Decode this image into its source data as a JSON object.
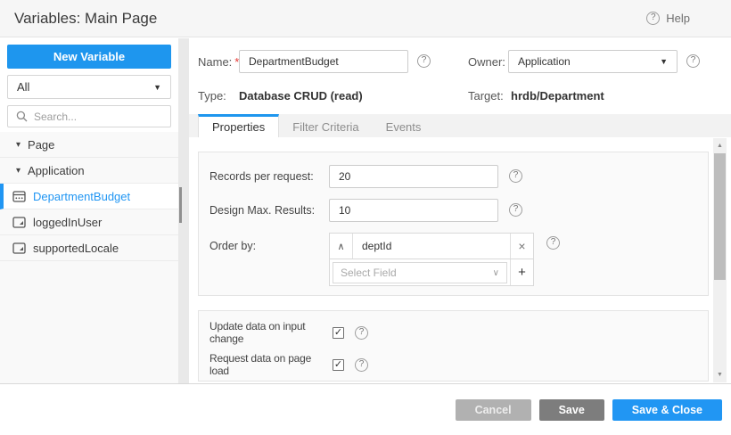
{
  "header": {
    "title": "Variables: Main Page",
    "help_label": "Help"
  },
  "glyphs": {
    "question": "?",
    "asterisk": "*",
    "triangle_down_small": "▾",
    "triangle_down": "▼",
    "chevron_up": "∧",
    "chevron_down": "∨",
    "close": "×",
    "plus": "+",
    "check": "✓",
    "scroll_up": "▲",
    "scroll_down": "▼"
  },
  "sidebar": {
    "new_variable_label": "New Variable",
    "filter_value": "All",
    "search_placeholder": "Search...",
    "tree": [
      {
        "label": "Page",
        "type": "group"
      },
      {
        "label": "Application",
        "type": "group"
      },
      {
        "label": "DepartmentBudget",
        "type": "crud-variable",
        "selected": true
      },
      {
        "label": "loggedInUser",
        "type": "variable"
      },
      {
        "label": "supportedLocale",
        "type": "variable"
      }
    ]
  },
  "form": {
    "name_label": "Name:",
    "name_value": "DepartmentBudget",
    "owner_label": "Owner:",
    "owner_value": "Application",
    "type_label": "Type:",
    "type_value": "Database CRUD (read)",
    "target_label": "Target:",
    "target_value": "hrdb/Department"
  },
  "tabs": [
    {
      "label": "Properties",
      "active": true
    },
    {
      "label": "Filter Criteria",
      "active": false
    },
    {
      "label": "Events",
      "active": false
    }
  ],
  "properties": {
    "records_label": "Records per request:",
    "records_value": "20",
    "max_results_label": "Design Max. Results:",
    "max_results_value": "10",
    "order_by_label": "Order by:",
    "order_field_value": "deptId",
    "select_field_placeholder": "Select Field",
    "update_on_change_label": "Update data on input change",
    "update_on_change_checked": true,
    "request_on_load_label": "Request data on page load",
    "request_on_load_checked": true
  },
  "footer": {
    "cancel_label": "Cancel",
    "save_label": "Save",
    "save_close_label": "Save & Close"
  },
  "colors": {
    "accent": "#2196f3",
    "primary_button": "#1e96ee",
    "cancel_button": "#b1b1b1",
    "save_button": "#7d7d7d",
    "required_marker": "#e53935",
    "header_bg": "#f6f6f6",
    "card_bg": "#fafafa",
    "tab_bar_bg": "#f2f2f2"
  }
}
